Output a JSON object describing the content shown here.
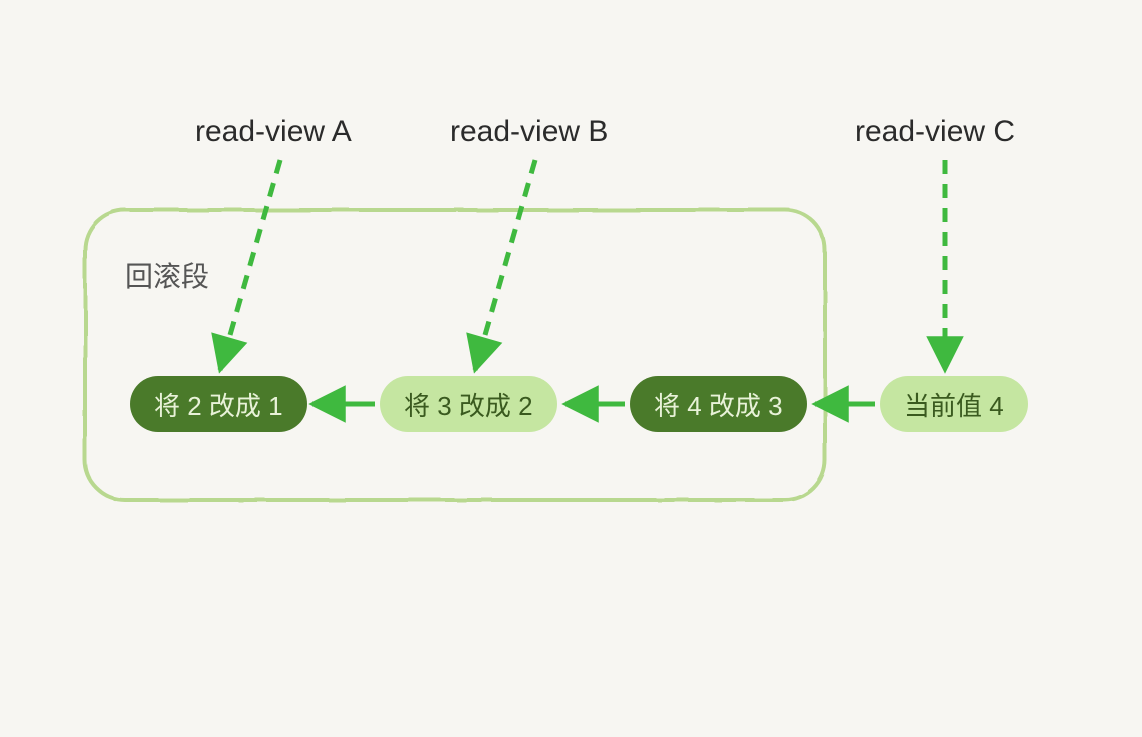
{
  "labels": {
    "readViewA": "read-view A",
    "readViewB": "read-view B",
    "readViewC": "read-view C"
  },
  "section": {
    "title": "回滚段"
  },
  "nodes": {
    "n1": "将 2 改成 1",
    "n2": "将 3 改成 2",
    "n3": "将 4 改成 3",
    "n4": "当前值 4"
  },
  "colors": {
    "bg": "#f7f6f2",
    "darkGreen": "#4a7a2a",
    "lightGreen": "#c5e6a1",
    "brightGreen": "#3fb93f",
    "outline": "#b8d88f",
    "text": "#2b2b2b"
  }
}
